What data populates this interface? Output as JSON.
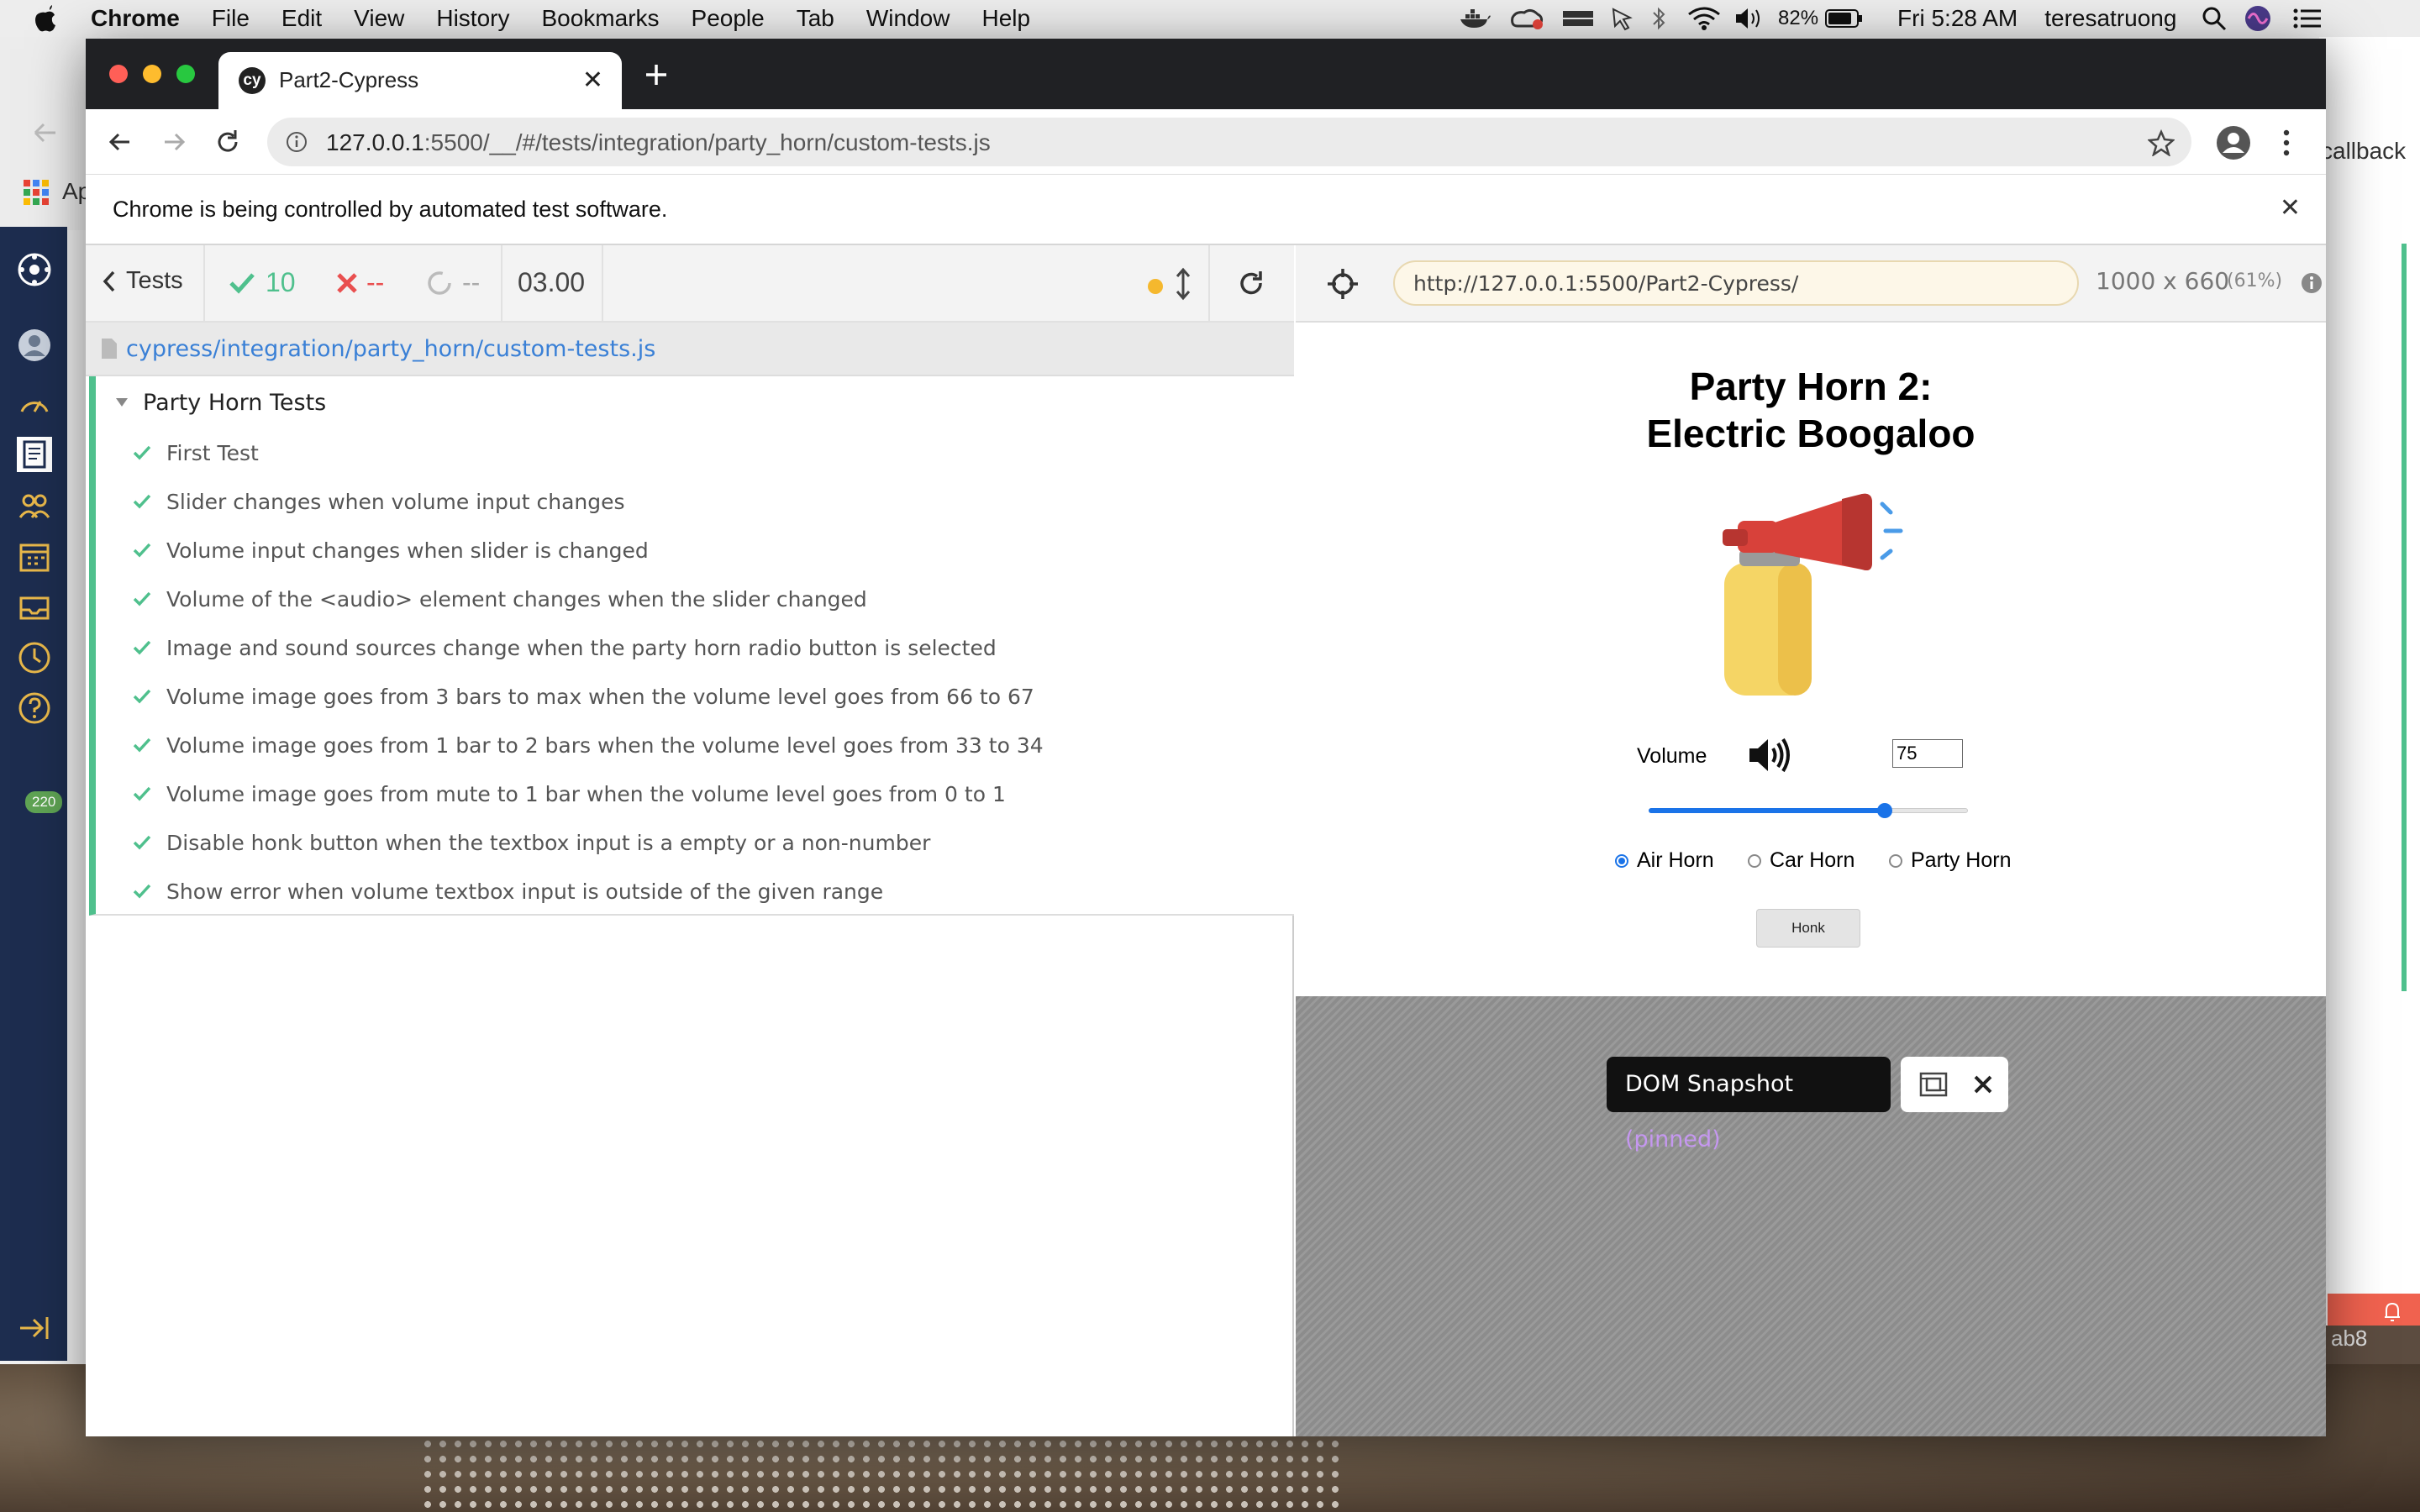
{
  "menubar": {
    "app": "Chrome",
    "items": [
      "File",
      "Edit",
      "View",
      "History",
      "Bookmarks",
      "People",
      "Tab",
      "Window",
      "Help"
    ],
    "battery": "82%",
    "clock": "Fri 5:28 AM",
    "user": "teresatruong"
  },
  "background_app": {
    "badge": "220",
    "right_text": "callback",
    "right_footer": "ab8",
    "left_partial": "Ap"
  },
  "browser": {
    "tab_title": "Part2-Cypress",
    "tab_icon_text": "cy",
    "url_host": "127.0.0.1",
    "url_rest": ":5500/__/#/tests/integration/party_horn/custom-tests.js",
    "infobar": "Chrome is being controlled by automated test software."
  },
  "runner": {
    "back_label": "Tests",
    "passed": "10",
    "failed": "--",
    "pending": "--",
    "duration": "03.00",
    "spec_path": "cypress/integration/party_horn/custom-tests.js",
    "suite_title": "Party Horn Tests",
    "tests": [
      "First Test",
      "Slider changes when volume input changes",
      "Volume input changes when slider is changed",
      "Volume of the <audio> element changes when the slider changed",
      "Image and sound sources change when the party horn radio button is selected",
      "Volume image goes from 3 bars to max when the volume level goes from 66 to 67",
      "Volume image goes from 1 bar to 2 bars when the volume level goes from 33 to 34",
      "Volume image goes from mute to 1 bar when the volume level goes from 0 to 1",
      "Disable honk button when the textbox input is a empty or a non-number",
      "Show error when volume textbox input is outside of the given range"
    ],
    "colors": {
      "pass": "#4fc08d",
      "fail": "#e94f4f",
      "accent": "#3a80d6",
      "running_dot": "#f5b82e"
    }
  },
  "aut": {
    "url": "http://127.0.0.1:5500/Part2-Cypress/",
    "size": "1000 x 660",
    "scale": "(61%)",
    "title_line1": "Party Horn 2:",
    "title_line2": "Electric Boogaloo",
    "volume_label": "Volume",
    "volume_value": "75",
    "slider_fraction": 0.75,
    "radios": [
      {
        "label": "Air Horn",
        "checked": true
      },
      {
        "label": "Car Horn",
        "checked": false
      },
      {
        "label": "Party Horn",
        "checked": false
      }
    ],
    "honk_label": "Honk",
    "snapshot_label": "DOM Snapshot",
    "snapshot_pinned": "(pinned)"
  }
}
